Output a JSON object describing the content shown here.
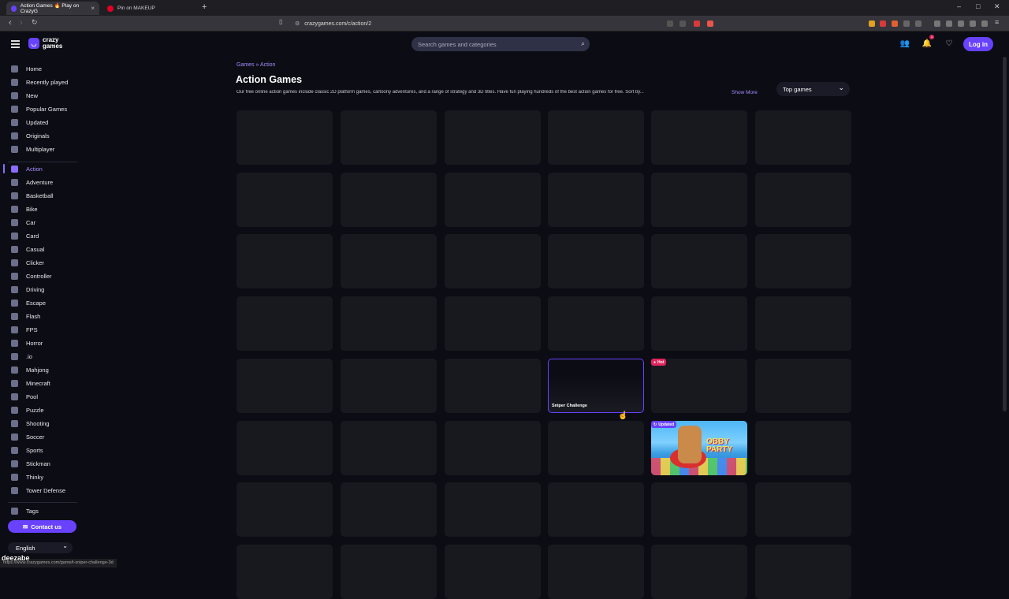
{
  "browser": {
    "tabs": [
      {
        "label": "Action Games 🔥 Play on CrazyG",
        "active": true
      },
      {
        "label": "Pin on MAKEUP",
        "active": false
      }
    ],
    "url": "crazygames.com/c/action/2",
    "status_url": "https://www.crazygames.com/game/t-sniper-challenge-3d"
  },
  "header": {
    "logo_line1": "crazy",
    "logo_line2": "games",
    "search_placeholder": "Search games and categories",
    "notifications_count": "1",
    "login_label": "Log in"
  },
  "sidebar": {
    "primary": [
      "Home",
      "Recently played",
      "New",
      "Popular Games",
      "Updated",
      "Originals",
      "Multiplayer"
    ],
    "categories": [
      "Action",
      "Adventure",
      "Basketball",
      "Bike",
      "Car",
      "Card",
      "Casual",
      "Clicker",
      "Controller",
      "Driving",
      "Escape",
      "Flash",
      "FPS",
      "Horror",
      ".io",
      "Mahjong",
      "Minecraft",
      "Pool",
      "Puzzle",
      "Shooting",
      "Soccer",
      "Sports",
      "Stickman",
      "Thinky",
      "Tower Defense"
    ],
    "active_category": "Action",
    "tags_label": "Tags",
    "contact_label": "Contact us",
    "language": "English"
  },
  "main": {
    "breadcrumb": "Games » Action",
    "title": "Action Games",
    "description": "Our free online action games include classic 2D platform games, cartoony adventures, and a range of strategy and 3D titles. Have fun playing hundreds of the best action games for free. Sort by...",
    "show_more": "Show More",
    "sort_value": "Top games",
    "hover_card_name": "Sniper Challenge",
    "badge_hot": "Hot",
    "badge_updated": "Updated",
    "obby_title": "OBBY PARTY"
  },
  "watermark": "deezabe"
}
